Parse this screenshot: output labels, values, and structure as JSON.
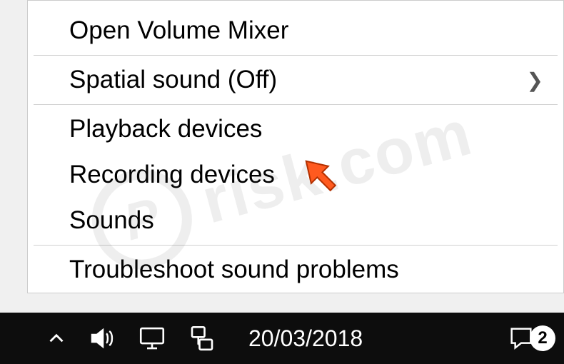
{
  "menu": {
    "items": [
      {
        "label": "Open Volume Mixer",
        "submenu": false
      },
      {
        "label": "Spatial sound (Off)",
        "submenu": true
      },
      {
        "label": "Playback devices",
        "submenu": false
      },
      {
        "label": "Recording devices",
        "submenu": false
      },
      {
        "label": "Sounds",
        "submenu": false
      },
      {
        "label": "Troubleshoot sound problems",
        "submenu": false
      }
    ]
  },
  "taskbar": {
    "date": "20/03/2018",
    "notification_count": "2"
  },
  "watermark": {
    "logo_letter": "P",
    "text": "risk.com"
  }
}
